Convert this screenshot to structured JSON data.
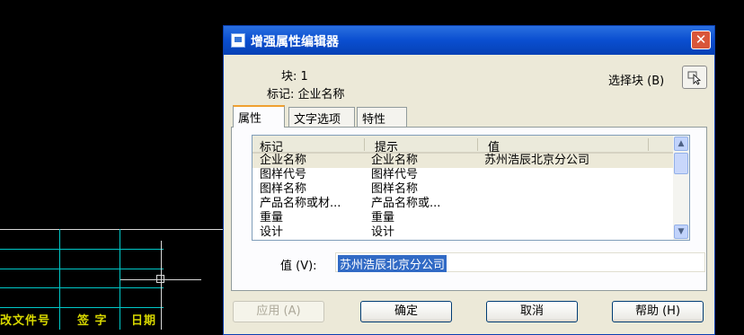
{
  "cad": {
    "texts": [
      "改文件号",
      "签 字",
      "日期"
    ]
  },
  "dialog": {
    "title": "增强属性编辑器",
    "block_label": "块: 1",
    "tag_label": "标记: 企业名称",
    "select_block_label": "选择块 (B)",
    "tabs": [
      {
        "label": "属性",
        "active": true
      },
      {
        "label": "文字选项",
        "active": false
      },
      {
        "label": "特性",
        "active": false
      }
    ],
    "list": {
      "columns": [
        "标记",
        "提示",
        "值"
      ],
      "rows": [
        {
          "tag": "企业名称",
          "prompt": "企业名称",
          "value": "苏州浩辰北京分公司",
          "selected": true
        },
        {
          "tag": "图样代号",
          "prompt": "图样代号",
          "value": ""
        },
        {
          "tag": "图样名称",
          "prompt": "图样名称",
          "value": ""
        },
        {
          "tag": "产品名称或材...",
          "prompt": "产品名称或...",
          "value": ""
        },
        {
          "tag": "重量",
          "prompt": "重量",
          "value": ""
        },
        {
          "tag": "设计",
          "prompt": "设计",
          "value": ""
        }
      ]
    },
    "value_label": "值 (V):",
    "value_input": "苏州浩辰北京分公司",
    "buttons": {
      "apply": "应用 (A)",
      "ok": "确定",
      "cancel": "取消",
      "help": "帮助 (H)"
    }
  },
  "colors": {
    "title_bar": "#0a4ed0",
    "dialog_bg": "#ece9d8",
    "cad_cyan": "#00c8c8",
    "cad_yellow": "#d8d800",
    "selection": "#316ac5"
  }
}
